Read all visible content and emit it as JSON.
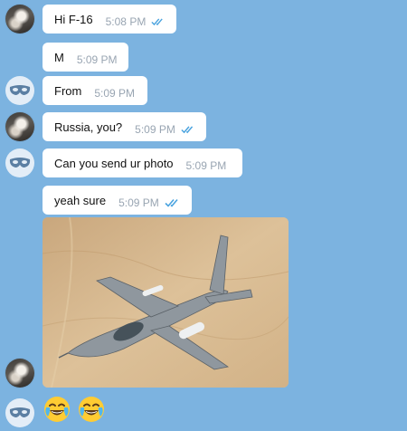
{
  "messages": [
    {
      "text": "Hi F-16",
      "time": "5:08 PM"
    },
    {
      "text": "M",
      "time": "5:09 PM"
    },
    {
      "text": "From",
      "time": "5:09 PM"
    },
    {
      "text": "Russia, you?",
      "time": "5:09 PM"
    },
    {
      "text": "Can you send ur photo",
      "time": "5:09 PM"
    },
    {
      "text": "yeah sure",
      "time": "5:09 PM"
    }
  ],
  "photo": {
    "subject": "F-16 fighter jet in flight over desert"
  },
  "emojis": [
    "face-with-tears-of-joy",
    "face-with-tears-of-joy"
  ],
  "colors": {
    "background": "#7cb3e0",
    "bubble": "#ffffff",
    "time": "#99a5b2",
    "ticks": "#4aa3df"
  }
}
